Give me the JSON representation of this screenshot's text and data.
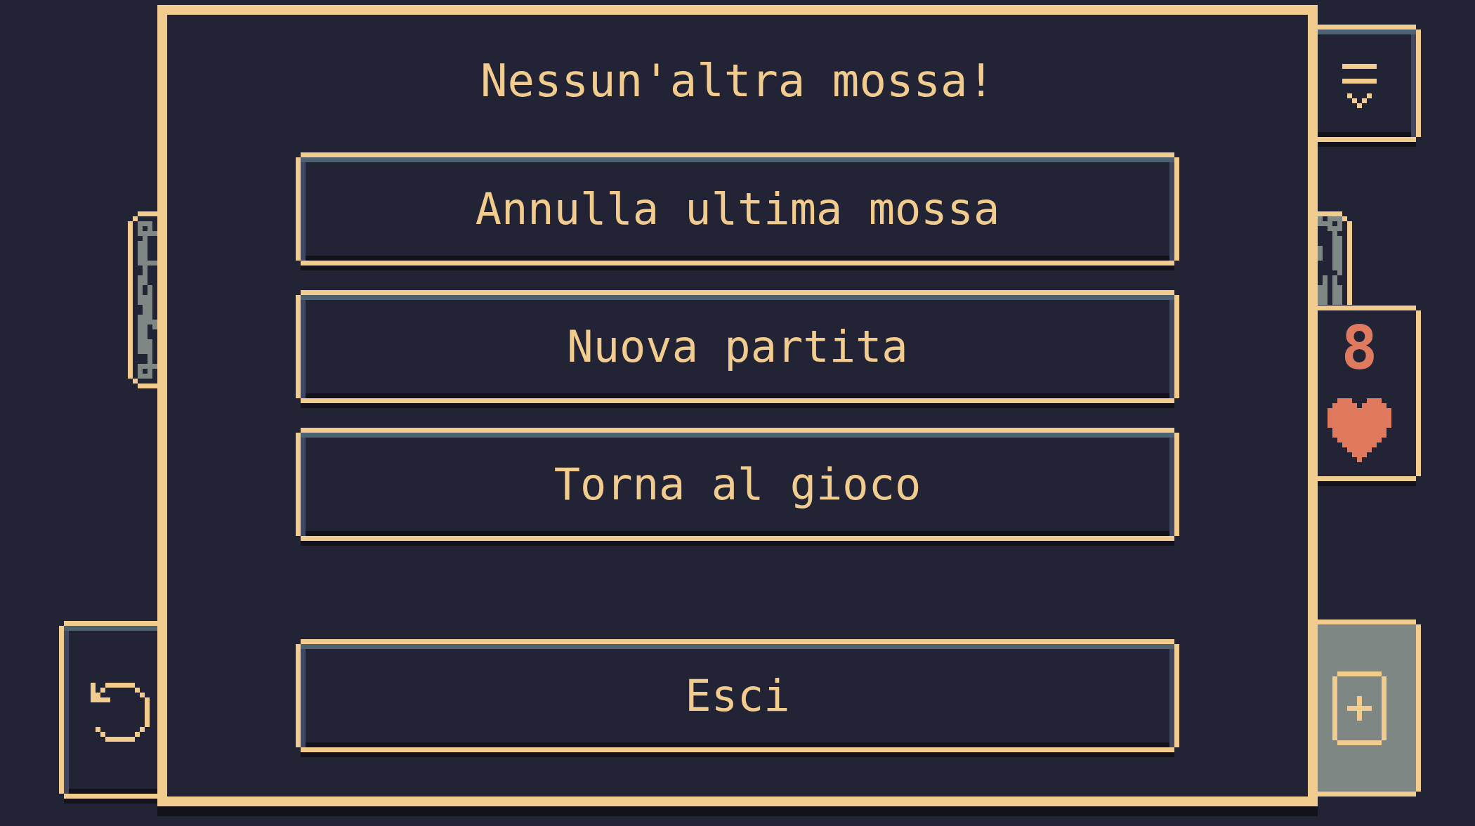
{
  "dialog": {
    "title": "Nessun'altra mossa!",
    "buttons": [
      {
        "label": "Annulla ultima mossa",
        "kind": "option"
      },
      {
        "label": "Nuova partita",
        "kind": "option"
      },
      {
        "label": "Torna al gioco",
        "kind": "option"
      },
      {
        "label": "Esci",
        "kind": "exit"
      }
    ]
  },
  "hud": {
    "counter": "8",
    "deck": {
      "disabled": true
    }
  }
}
